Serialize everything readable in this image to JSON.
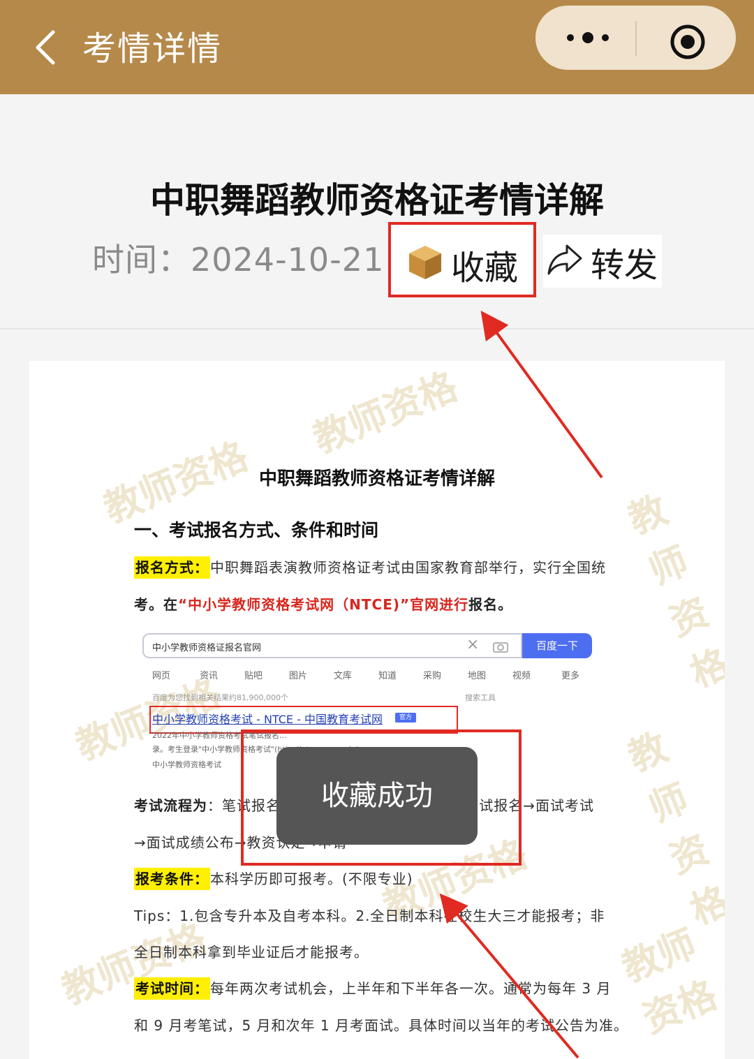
{
  "nav": {
    "title": "考情详情",
    "back_icon": "chevron-left-icon",
    "more_icon": "more-dots-icon",
    "close_icon": "target-circle-icon",
    "bar_color": "#b5894a"
  },
  "article": {
    "title": "中职舞蹈教师资格证考情详解",
    "time": "时间：2024-10-21",
    "favorite_label": "收藏",
    "favorite_icon": "package-box-icon",
    "share_label": "转发",
    "share_icon": "share-arrow-icon"
  },
  "document": {
    "title": "中职舞蹈教师资格证考情详解",
    "section1": "一、考试报名方式、条件和时间",
    "reg_label": "报名方式：",
    "reg_text": "中职舞蹈表演教师资格证考试由国家教育部举行，实行全国统",
    "reg_text2_a": "考。在",
    "reg_text2_red": "“中小学教师资格考试网（NTCE)”官网进行",
    "reg_text2_b": "报名。",
    "search": {
      "query": "中小学教师资格证报名官网",
      "button": "百度一下",
      "tabs": [
        "网页",
        "资讯",
        "贴吧",
        "图片",
        "文库",
        "知道",
        "采购",
        "地图",
        "视频",
        "更多"
      ],
      "result_count": "百度为您找到相关结果约81,900,000个",
      "tools": "搜索工具",
      "result_title": "中小学教师资格考试 - NTCE - 中国教育考试网",
      "badge": "官方",
      "snippet1": "2022年中小学教师资格考试笔试报名...",
      "snippet2": "录。考生登录\"中小学教师资格考试\"(http://ntce.neea.edu)...",
      "snippet3": "中小学教师资格考试"
    },
    "flow_label": "考试流程为",
    "flow_text": "：笔试报名→笔试考试→笔试成绩公布→面试报名→面试考试",
    "flow_text2": "→面试成绩公布→教资认定→申请",
    "cond_label": "报考条件：",
    "cond_text": "本科学历即可报考。(不限专业)",
    "tips1": "Tips：1.包含专升本及自考本科。2.全日制本科在校生大三才能报考；非",
    "tips2": "全日制本科拿到毕业证后才能报考。",
    "time_label": "考试时间：",
    "time_text": "每年两次考试机会，上半年和下半年各一次。通常为每年 3 月",
    "time_text2": "和 9 月考笔试，5 月和次年 1 月考面试。具体时间以当年的考试公告为准。",
    "watermark": "教师资格"
  },
  "toast": {
    "text": "收藏成功"
  },
  "annotation_color": "#e02a22"
}
